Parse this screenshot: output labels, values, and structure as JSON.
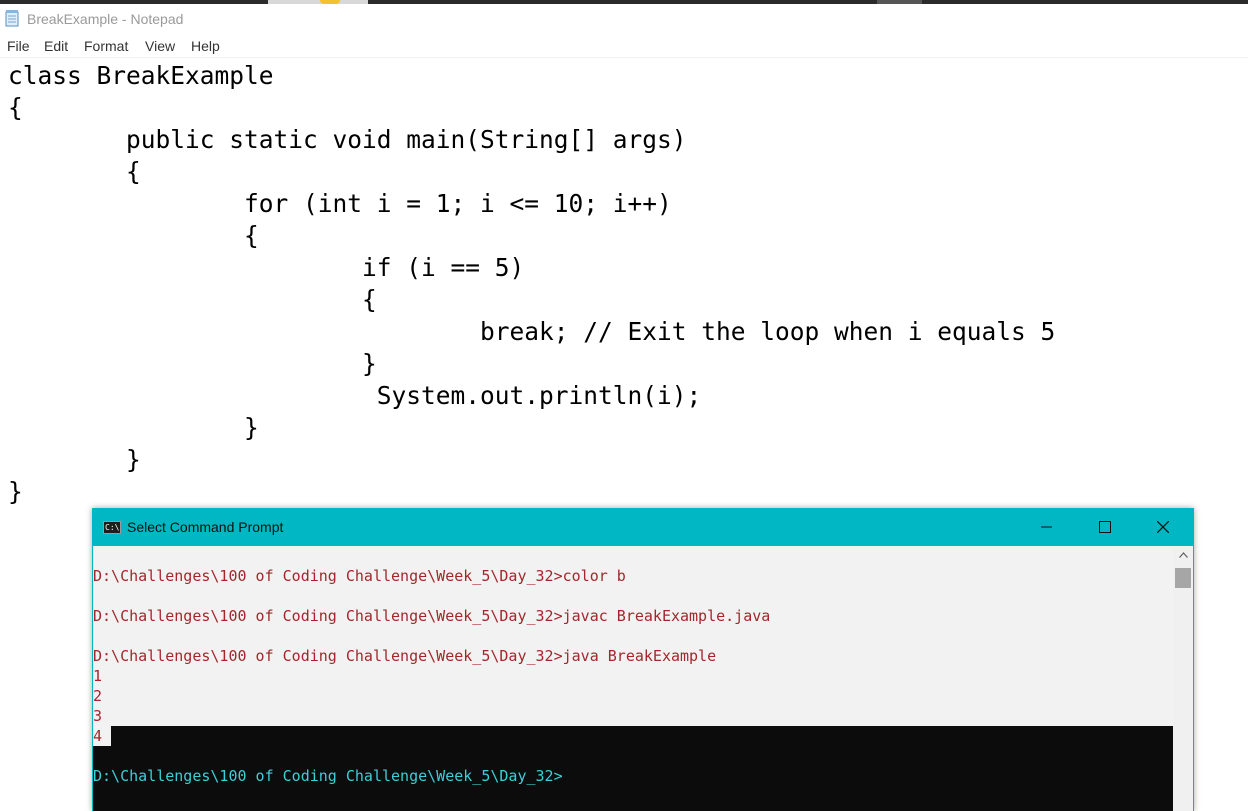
{
  "notepad": {
    "title": "BreakExample - Notepad",
    "menu": [
      "File",
      "Edit",
      "Format",
      "View",
      "Help"
    ],
    "code_lines": [
      "class BreakExample",
      "{",
      "        public static void main(String[] args)",
      "        {",
      "                for (int i = 1; i <= 10; i++)",
      "                {",
      "                        if (i == 5)",
      "                        {",
      "                                break; // Exit the loop when i equals 5",
      "                        }",
      "                         System.out.println(i);",
      "                }",
      "        }",
      "}"
    ]
  },
  "cmd": {
    "title": "Select Command Prompt",
    "lines": [
      "",
      "D:\\Challenges\\100 of Coding Challenge\\Week_5\\Day_32>color b",
      "",
      "D:\\Challenges\\100 of Coding Challenge\\Week_5\\Day_32>javac BreakExample.java",
      "",
      "D:\\Challenges\\100 of Coding Challenge\\Week_5\\Day_32>java BreakExample",
      "1",
      "2",
      "3",
      "4",
      "",
      "D:\\Challenges\\100 of Coding Challenge\\Week_5\\Day_32>"
    ],
    "selected_line_count": 10,
    "selected_text_color": "#a4262c",
    "normal_text_color": "#3ad0d8"
  },
  "icons": {
    "notepad": "notepad-icon",
    "cmd": "cmd-icon",
    "minimize": "minimize-icon",
    "maximize": "maximize-icon",
    "close": "close-icon",
    "scroll_up": "chevron-up-icon"
  }
}
